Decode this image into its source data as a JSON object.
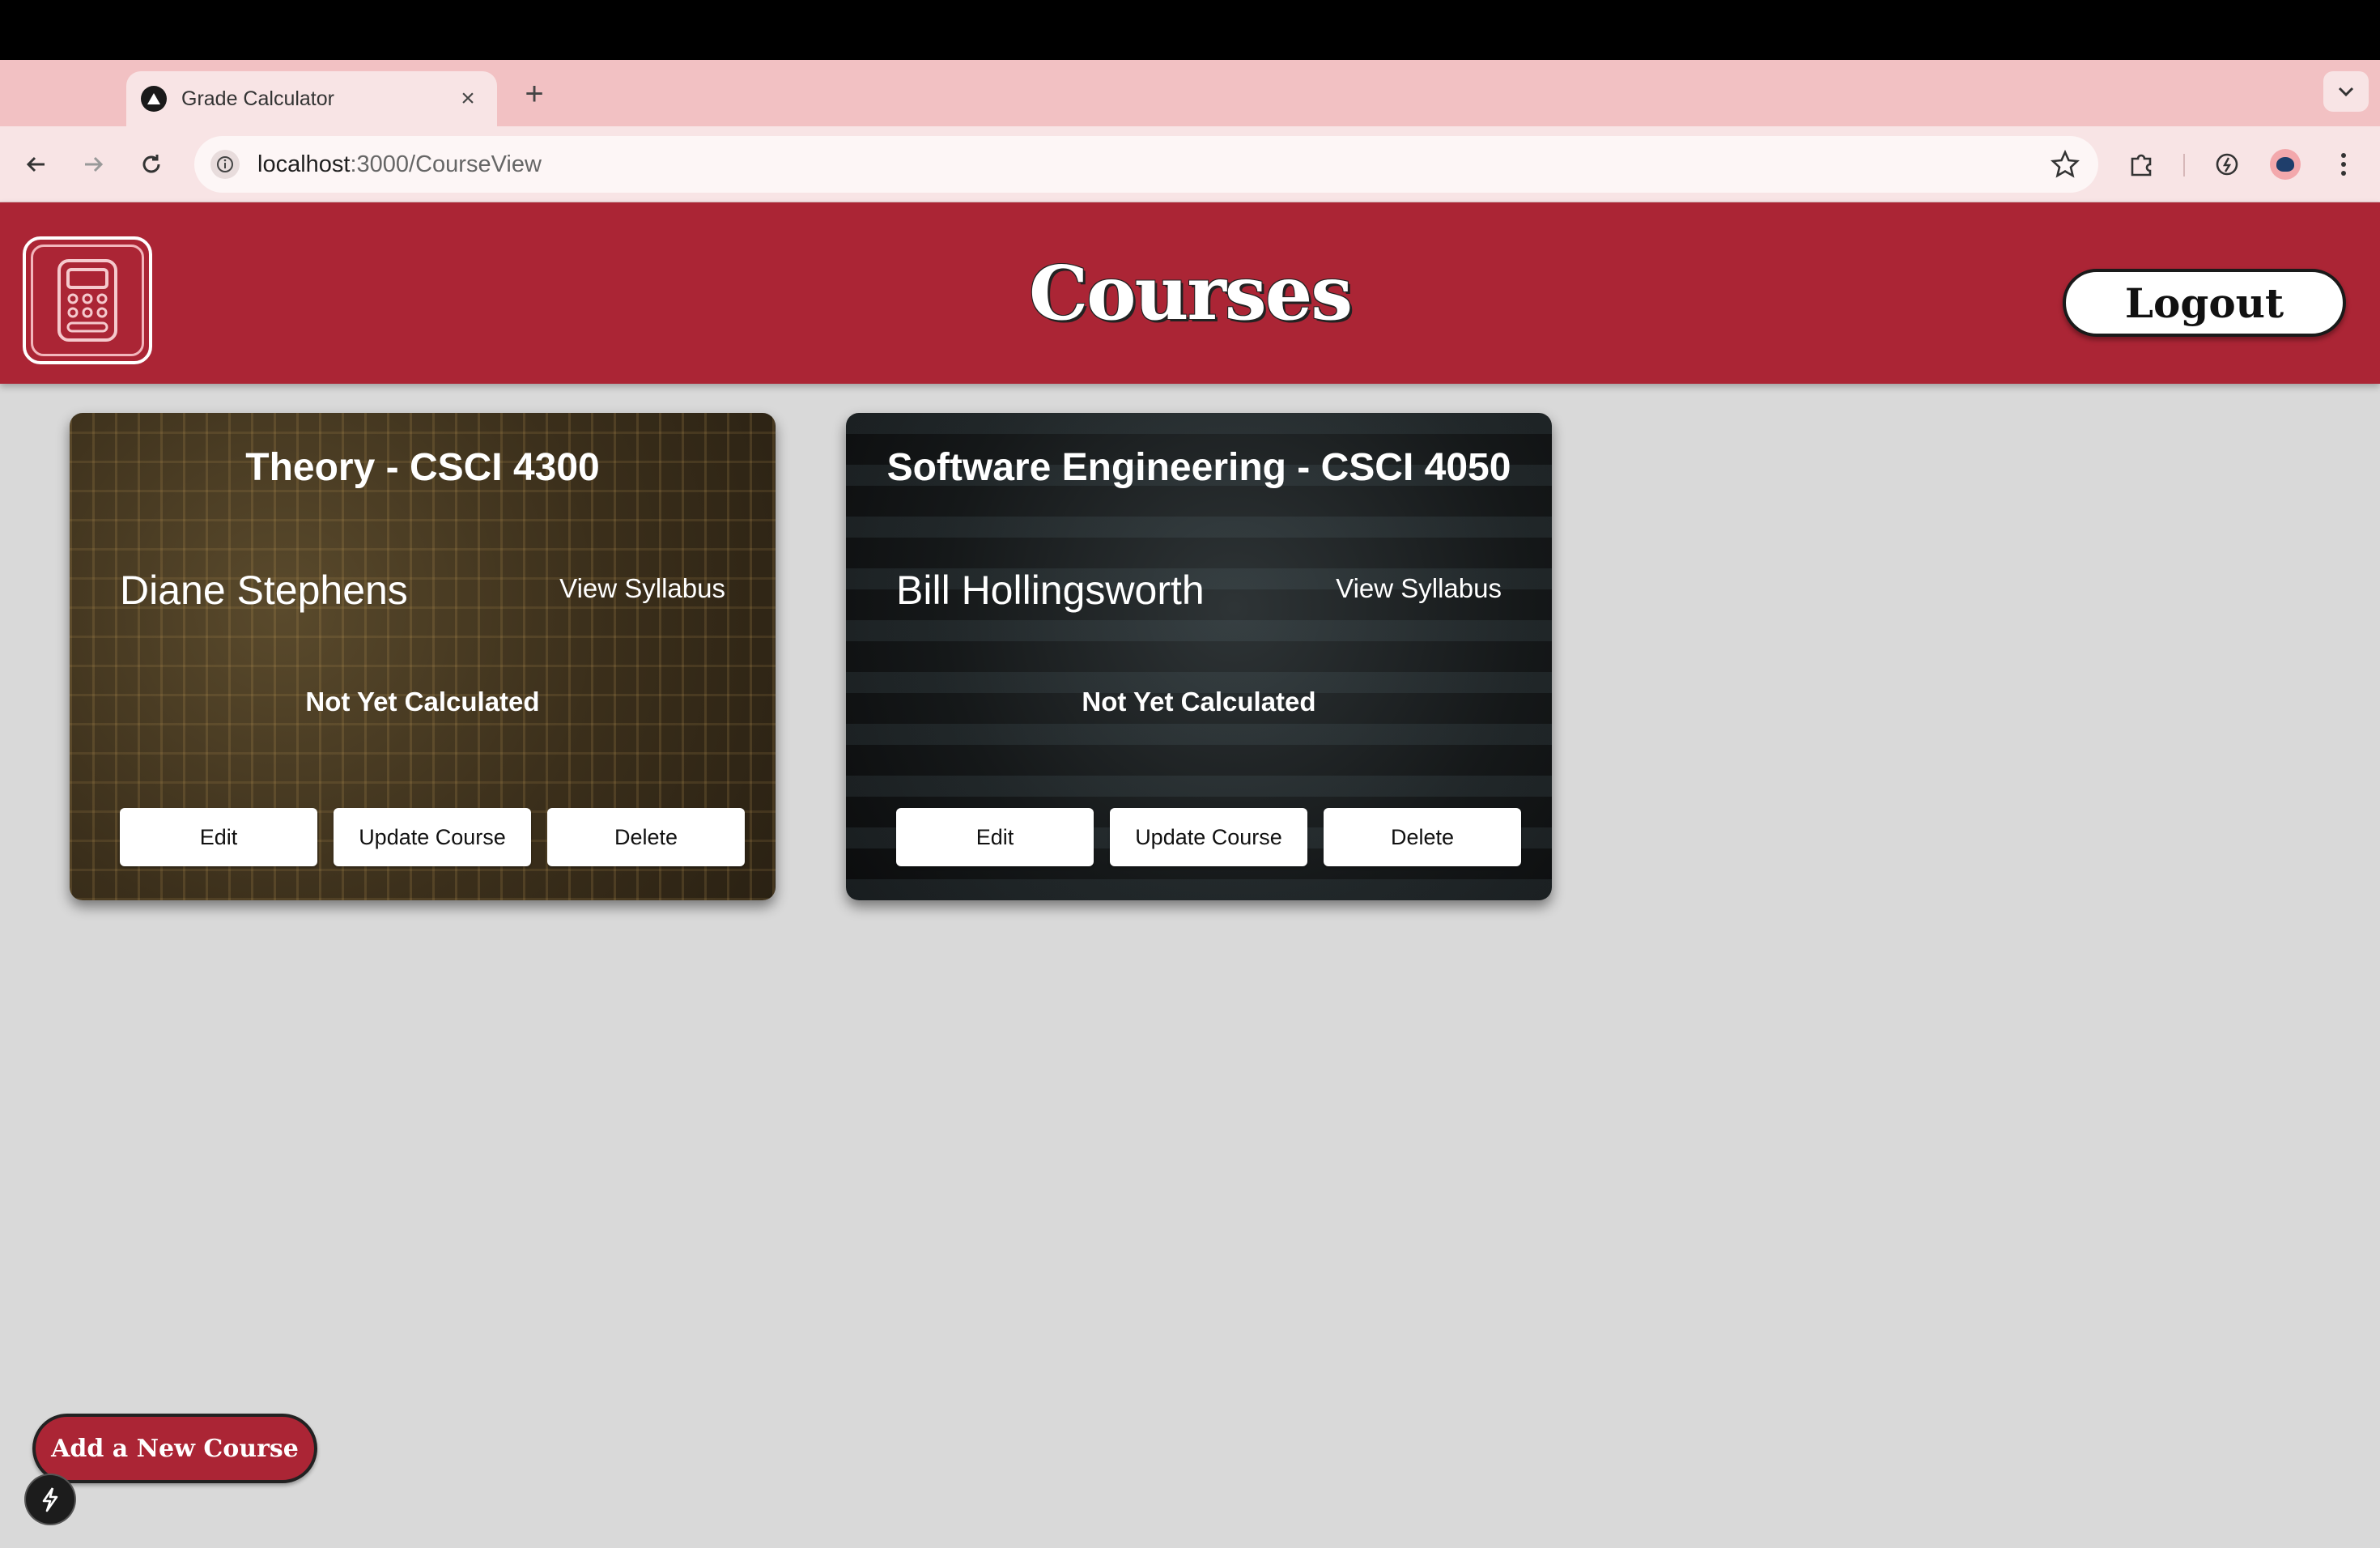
{
  "browser": {
    "tab": {
      "title": "Grade Calculator",
      "close": "×"
    },
    "new_tab": "+",
    "url": {
      "host": "localhost",
      "path": ":3000/CourseView"
    }
  },
  "header": {
    "title": "Courses",
    "logout_label": "Logout",
    "accent_color": "#ab2535"
  },
  "courses": [
    {
      "title": "Theory - CSCI 4300",
      "instructor": "Diane Stephens",
      "syllabus_label": "View Syllabus",
      "grade_status": "Not Yet Calculated",
      "buttons": {
        "edit": "Edit",
        "update": "Update Course",
        "delete": "Delete"
      }
    },
    {
      "title": "Software Engineering - CSCI 4050",
      "instructor": "Bill Hollingsworth",
      "syllabus_label": "View Syllabus",
      "grade_status": "Not Yet Calculated",
      "buttons": {
        "edit": "Edit",
        "update": "Update Course",
        "delete": "Delete"
      }
    }
  ],
  "add_course_label": "Add a New Course"
}
